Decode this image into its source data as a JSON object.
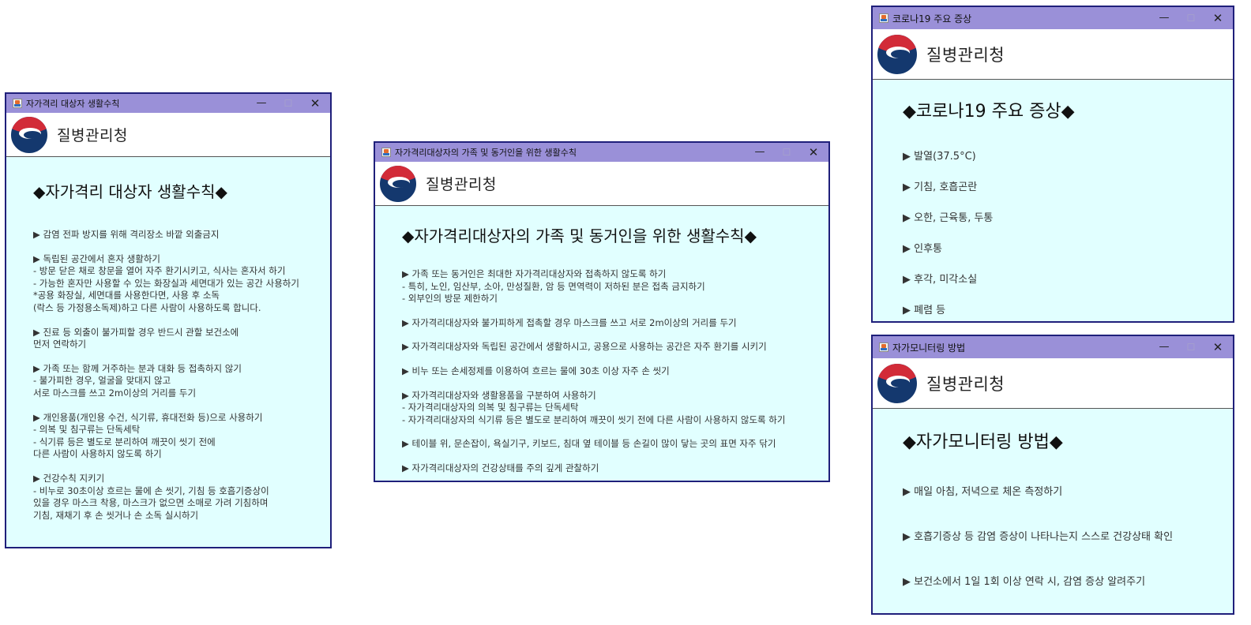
{
  "org_name": "질병관리청",
  "window_controls": {
    "minimize": "—",
    "maximize": "☐",
    "close": "✕"
  },
  "win1": {
    "title": "자가격리 대상자 생활수칙",
    "heading": "◆자가격리 대상자 생활수칙◆",
    "lines": [
      "▶ 감염 전파 방지를 위해 격리장소 바깥 외출금지",
      "",
      "▶ 독립된 공간에서 혼자 생활하기",
      "- 방문 닫은 채로 창문을 열어 자주 환기시키고, 식사는 혼자서 하기",
      "- 가능한 혼자만 사용할 수 있는 화장실과 세면대가 있는 공간 사용하기",
      "*공용 화장실, 세면대를 사용한다면, 사용 후 소독",
      "(락스 등 가정용소독제)하고 다른 사람이 사용하도록 합니다.",
      "",
      "▶ 진료 등 외출이 불가피할 경우 반드시 관할 보건소에",
      "먼저 연락하기",
      "",
      "▶ 가족 또는 함께 거주하는 분과 대화 등 접촉하지 않기",
      "- 불가피한 경우, 얼굴을 맞대지 않고",
      "서로 마스크를 쓰고 2m이상의 거리를 두기",
      "",
      "▶ 개인용품(개인용 수건, 식기류, 휴대전화 등)으로 사용하기",
      "- 의복 및 침구류는 단독세탁",
      "- 식기류 등은 별도로 분리하여 깨끗이 씻기 전에",
      "다른 사람이 사용하지 않도록 하기",
      "",
      "▶ 건강수칙 지키기",
      "- 비누로 30초이상 흐르는 물에 손 씻기, 기침 등 호흡기증상이",
      "있을 경우 마스크 착용, 마스크가 없으면 소매로 가려 기침하며",
      "기침, 재채기 후 손 씻거나 손 소독 실시하기"
    ]
  },
  "win2": {
    "title": "자가격리대상자의 가족 및 동거인을 위한 생활수칙",
    "heading": "◆자가격리대상자의 가족 및 동거인을 위한 생활수칙◆",
    "lines": [
      "▶ 가족 또는 동거인은 최대한 자가격리대상자와 접촉하지 않도록 하기",
      "- 특히, 노인, 임산부, 소아, 만성질환, 암 등 면역력이 저하된 분은 접촉 금지하기",
      "- 외부인의 방문 제한하기",
      "",
      "▶ 자가격리대상자와 불가피하게 접촉할 경우 마스크를 쓰고 서로 2m이상의 거리를 두기",
      "",
      "▶ 자가격리대상자와 독립된 공간에서 생활하시고, 공용으로 사용하는 공간은 자주 환기를 시키기",
      "",
      "▶ 비누 또는 손세정제를 이용하여 흐르는 물에 30초 이상 자주 손 씻기",
      "",
      "▶ 자가격리대상자와 생활용품을 구분하여 사용하기",
      "- 자가격리대상자의 의복 및 침구류는 단독세탁",
      "- 자가격리대상자의 식기류 등은 별도로 분리하여 깨끗이 씻기 전에 다른 사람이 사용하지 않도록 하기",
      "",
      "▶ 테이블 위, 문손잡이, 욕실기구, 키보드, 침대 옆 테이블 등 손길이 많이 닿는 곳의 표면 자주 닦기",
      "",
      "▶ 자가격리대상자의 건강상태를 주의 깊게 관찰하기"
    ]
  },
  "win3": {
    "title": "코로나19 주요 증상",
    "heading": "◆코로나19 주요 증상◆",
    "items": [
      "▶ 발열(37.5°C)",
      "▶ 기침, 호흡곤란",
      "▶ 오한, 근육통, 두통",
      "▶ 인후통",
      "▶ 후각, 미각소실",
      "▶ 폐렴 등"
    ]
  },
  "win4": {
    "title": "자가모니터링 방법",
    "heading": "◆자가모니터링 방법◆",
    "items": [
      "▶ 매일 아침, 저녁으로 체온 측정하기",
      "▶ 호흡기증상 등 감염 증상이 나타나는지 스스로 건강상태 확인",
      "▶ 보건소에서 1일 1회 이상 연락 시, 감염 증상 알려주기"
    ]
  }
}
